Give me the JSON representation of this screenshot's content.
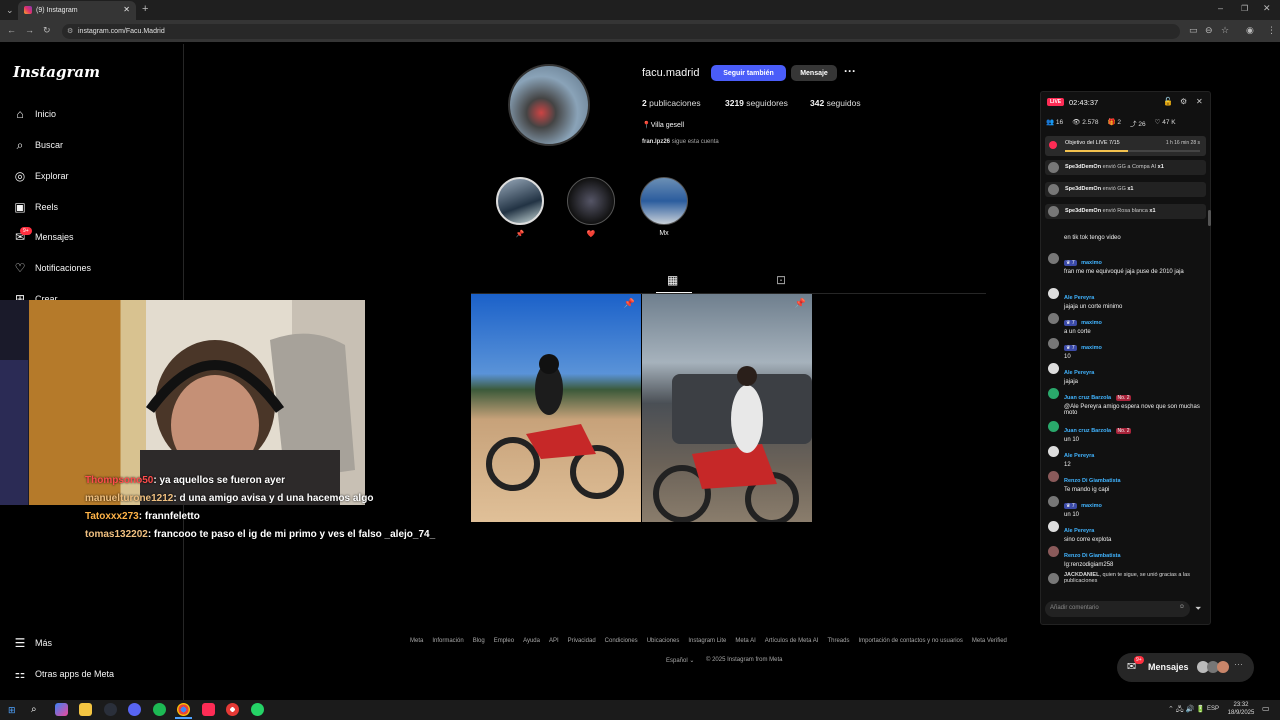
{
  "browser": {
    "tab_title": "(9) Instagram",
    "url": "instagram.com/Facu.Madrid"
  },
  "sidebar": {
    "logo": "Instagram",
    "items": [
      {
        "label": "Inicio"
      },
      {
        "label": "Buscar"
      },
      {
        "label": "Explorar"
      },
      {
        "label": "Reels"
      },
      {
        "label": "Mensajes",
        "badge": "9+"
      },
      {
        "label": "Notificaciones"
      },
      {
        "label": "Crear"
      }
    ],
    "more": "Más",
    "meta_apps": "Otras apps de Meta"
  },
  "profile": {
    "username": "facu.madrid",
    "follow_label": "Seguir también",
    "message_label": "Mensaje",
    "posts_count": "2",
    "posts_label": "publicaciones",
    "followers_count": "3219",
    "followers_label": "seguidores",
    "following_count": "342",
    "following_label": "seguidos",
    "location": "📍Villa gesell",
    "followed_by_user": "fran.lpz26",
    "followed_by_text": "sigue esta cuenta",
    "highlights": [
      {
        "label": "📌"
      },
      {
        "label": "❤️"
      },
      {
        "label": "Mx"
      }
    ]
  },
  "footer": {
    "links": [
      "Meta",
      "Información",
      "Blog",
      "Empleo",
      "Ayuda",
      "API",
      "Privacidad",
      "Condiciones",
      "Ubicaciones",
      "Instagram Lite",
      "Meta AI",
      "Artículos de Meta AI",
      "Threads",
      "Importación de contactos y no usuarios",
      "Meta Verified"
    ],
    "language": "Español",
    "copyright": "© 2025 Instagram from Meta"
  },
  "live": {
    "badge": "LIVE",
    "timer": "02:43:37",
    "stats": {
      "users": "16",
      "views": "2.578",
      "gifts": "2",
      "shares": "26",
      "likes": "47 K"
    },
    "goal_label": "Objetivo del LIVE",
    "goal_value": "7/15",
    "goal_time": "1 h 16 min 28 s",
    "gifts": [
      {
        "user": "Spe3dDemOn",
        "text": "envió GG a Compa AI",
        "count": "x1"
      },
      {
        "user": "Spe3dDemOn",
        "text": "envió GG",
        "count": "x1"
      },
      {
        "user": "Spe3dDemOn",
        "text": "envió Rosa blanca",
        "count": "x1"
      }
    ],
    "chat": [
      {
        "name": "",
        "msg": "en tik tok tengo video"
      },
      {
        "name": "maximo",
        "msg": "fran me me equivoqué jaja puse de 2010 jaja"
      },
      {
        "name": "Ale Pereyra",
        "msg": "jajaja un corte minimo"
      },
      {
        "name": "maximo",
        "msg": "a un corte"
      },
      {
        "name": "maximo",
        "msg": "10"
      },
      {
        "name": "Ale Pereyra",
        "msg": "jajaja"
      },
      {
        "name": "Juan cruz Barzola",
        "msg": "@Ale Pereyra amigo espera nove que son muchas moto"
      },
      {
        "name": "Juan cruz Barzola",
        "msg": "un 10"
      },
      {
        "name": "Ale Pereyra",
        "msg": "12"
      },
      {
        "name": "Renzo  Di Giambatista",
        "msg": "Te mando ig capi"
      },
      {
        "name": "maximo",
        "msg": "un 10"
      },
      {
        "name": "Ale Pereyra",
        "msg": "sino corre explota"
      },
      {
        "name": "Renzo  Di Giambatista",
        "msg": "Ig:renzodigiam258"
      }
    ],
    "join_user": "JACKDANIEL",
    "join_text": ", quien te sigue, se unió gracias a las publicaciones",
    "comment_placeholder": "Añadir comentario"
  },
  "stream_overlay": [
    {
      "user": "Thompsono50",
      "text": ": ya aquellos se fueron ayer",
      "color": "#ff4d4d"
    },
    {
      "user": "manuelturone1212",
      "text": ": d una amigo avisa y d una hacemos algo",
      "color": "#f0c080"
    },
    {
      "user": "Tatoxxx273",
      "text": ": frannfeletto",
      "color": "#ffb347"
    },
    {
      "user": "tomas132202",
      "text": ": francooo te paso el ig de mi primo y ves el falso _alejo_74_",
      "color": "#f0c080"
    }
  ],
  "messages_pill": {
    "label": "Mensajes",
    "badge": "9+"
  },
  "taskbar": {
    "lang": "ESP",
    "time": "23:32",
    "date": "18/9/2025"
  },
  "colors": {
    "accent": "#4a5df9",
    "live_red": "#fe2c55",
    "chat_blue": "#41b4ff"
  }
}
